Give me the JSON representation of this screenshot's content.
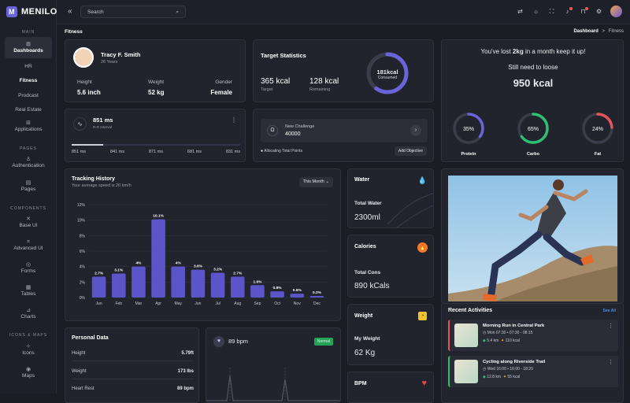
{
  "app": {
    "name": "MENILO"
  },
  "sidebar": {
    "sections": {
      "main": "MAIN",
      "pages": "PAGES",
      "components": "COMPONENTS",
      "icons_maps": "ICONS & MAPS"
    },
    "items": [
      "Dashboards",
      "HR",
      "Fitness",
      "Prodcast",
      "Real Estate",
      "Applications",
      "Authentication",
      "Pages",
      "Base UI",
      "Advanced UI",
      "Forms",
      "Tables",
      "Charts",
      "Icons",
      "Maps"
    ]
  },
  "topbar": {
    "search_placeholder": "Search"
  },
  "breadcrumb": {
    "title": "Fitness",
    "home": "Dashboard",
    "sep": ">",
    "current": "Fitness"
  },
  "profile": {
    "name": "Tracy F. Smith",
    "age": "26 Years",
    "height_label": "Height",
    "height": "5.6 inch",
    "weight_label": "Weight",
    "weight": "52 kg",
    "gender_label": "Gender",
    "gender": "Female"
  },
  "rr": {
    "value": "851 ms",
    "label": "R-R Interval",
    "readings": [
      "851 ms",
      "841 ms",
      "871 ms",
      "681 ms",
      "831 ms"
    ],
    "more": "⋮"
  },
  "target": {
    "title": "Target Statistics",
    "target_value": "365 kcal",
    "target_label": "Target",
    "remaining_value": "128 kcal",
    "remaining_label": "Remaining",
    "ring_value": "181kcal",
    "ring_label": "Consumed",
    "ring_fraction": 0.6
  },
  "challenge": {
    "label": "New Challenge",
    "value": "40000",
    "allocating": "Allocating Total Points",
    "button": "Add Objective"
  },
  "loss": {
    "line_pre": "You've lost ",
    "line_bold": "2kg",
    "line_post": " in a month keep it up!",
    "need": "Still need to loose",
    "kcal": "950 kcal",
    "macros": [
      {
        "name": "Protein",
        "pct": "35%",
        "fraction": 0.35,
        "color": "#6b63d9"
      },
      {
        "name": "Carbo",
        "pct": "65%",
        "fraction": 0.65,
        "color": "#2fbf71"
      },
      {
        "name": "Fat",
        "pct": "24%",
        "fraction": 0.24,
        "color": "#e5555b"
      }
    ]
  },
  "tracking": {
    "title": "Tracking History",
    "subtitle": "Your average speed is 20 km/h",
    "filter": "This Month"
  },
  "chart_data": {
    "type": "bar",
    "categories": [
      "Jun",
      "Feb",
      "Mar",
      "Apr",
      "May",
      "Jun",
      "Jul",
      "Aug",
      "Sep",
      "Oct",
      "Nov",
      "Dec"
    ],
    "values": [
      2.7,
      3.1,
      4,
      10.1,
      4,
      3.6,
      3.2,
      2.7,
      1.6,
      0.8,
      0.5,
      0.2
    ],
    "labels": [
      "2.7%",
      "3.1%",
      "4%",
      "10.1%",
      "4%",
      "3.6%",
      "3.2%",
      "2.7%",
      "1.6%",
      "0.8%",
      "0.5%",
      "0.2%"
    ],
    "yticks": [
      "0%",
      "2%",
      "4%",
      "6%",
      "8%",
      "10%",
      "12%"
    ],
    "ylim": [
      0,
      12
    ],
    "grid": true
  },
  "water": {
    "title": "Water",
    "label": "Total Water",
    "value": "2300ml"
  },
  "calories": {
    "title": "Calories",
    "label": "Total Cons",
    "value": "890 kCals"
  },
  "weight": {
    "title": "Weight",
    "label": "My Weight",
    "value": "62 Kg"
  },
  "bpm_card": {
    "title": "BPM"
  },
  "personal": {
    "title": "Personal Data",
    "rows": [
      {
        "k": "Height",
        "v": "5.79ft"
      },
      {
        "k": "Weight",
        "v": "173 lbs"
      },
      {
        "k": "Heart Rest",
        "v": "89 bpm"
      }
    ]
  },
  "heart": {
    "value": "89 bpm",
    "badge": "Normal"
  },
  "activities": {
    "title": "Recent Activities",
    "see_all": "See All",
    "items": [
      {
        "title": "Morning Run in Central Park",
        "time": "Mon 07:30 • 07:30 - 08:15",
        "distance": "5.4 km",
        "kcal": "110 kcal"
      },
      {
        "title": "Cycling along Riverside Trail",
        "time": "Wed 16:00 • 16:00 - 18:20",
        "distance": "12.8 km",
        "kcal": "55 kcal"
      }
    ]
  }
}
